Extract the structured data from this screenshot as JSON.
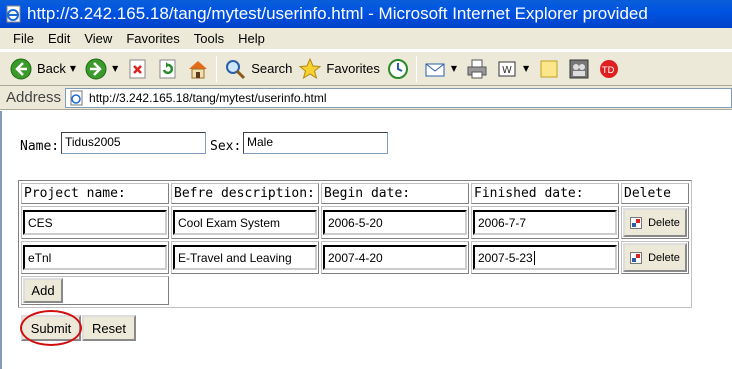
{
  "window": {
    "title": "http://3.242.165.18/tang/mytest/userinfo.html - Microsoft Internet Explorer provided"
  },
  "menu": [
    "File",
    "Edit",
    "View",
    "Favorites",
    "Tools",
    "Help"
  ],
  "toolbar": {
    "back": "Back",
    "search": "Search",
    "favorites": "Favorites"
  },
  "address": {
    "label": "Address",
    "url": "http://3.242.165.18/tang/mytest/userinfo.html"
  },
  "form": {
    "name_label": "Name:",
    "name_value": "Tidus2005",
    "sex_label": "Sex:",
    "sex_value": "Male"
  },
  "table": {
    "headers": [
      "Project name:",
      "Befre description:",
      "Begin date:",
      "Finished date:",
      "Delete"
    ],
    "rows": [
      {
        "name": "CES",
        "description": "Cool Exam System",
        "begin": "2006-5-20",
        "finished": "2006-7-7",
        "delete": "Delete"
      },
      {
        "name": "eTnl",
        "description": "E-Travel and Leaving",
        "begin": "2007-4-20",
        "finished": "2007-5-23",
        "delete": "Delete"
      }
    ],
    "add_label": "Add"
  },
  "buttons": {
    "submit": "Submit",
    "reset": "Reset"
  },
  "colors": {
    "titlebar": "#0054e3",
    "chrome": "#ece9d8",
    "highlight_ring": "#d01010"
  }
}
